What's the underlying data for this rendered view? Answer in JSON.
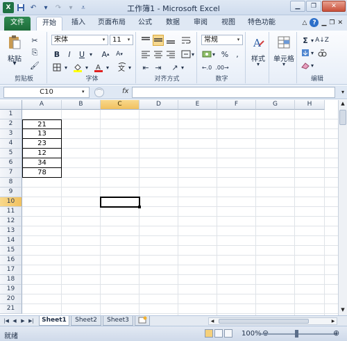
{
  "window": {
    "title": "工作簿1 - Microsoft Excel",
    "app_icon": "X"
  },
  "ribbon_tabs": [
    "文件",
    "开始",
    "插入",
    "页面布局",
    "公式",
    "数据",
    "审阅",
    "视图",
    "特色功能"
  ],
  "ribbon": {
    "clipboard": {
      "paste": "粘贴",
      "group_label": "剪贴板"
    },
    "font": {
      "name": "宋体",
      "size": "11",
      "bold": "B",
      "italic": "I",
      "underline": "U",
      "group_label": "字体"
    },
    "alignment": {
      "group_label": "对齐方式"
    },
    "number": {
      "format": "常规",
      "percent": "%",
      "group_label": "数字"
    },
    "styles": {
      "label": "样式"
    },
    "cells": {
      "label": "单元格"
    },
    "editing": {
      "group_label": "编辑"
    }
  },
  "formula_bar": {
    "name_box": "C10",
    "fx": "fx",
    "value": ""
  },
  "columns": [
    "A",
    "B",
    "C",
    "D",
    "E",
    "F",
    "G",
    "H"
  ],
  "rows": [
    "1",
    "2",
    "3",
    "4",
    "5",
    "6",
    "7",
    "8",
    "9",
    "10",
    "11",
    "12",
    "13",
    "14",
    "15",
    "16",
    "17",
    "18",
    "19",
    "20",
    "21"
  ],
  "cells": {
    "a2": "21",
    "a3": "13",
    "a4": "23",
    "a5": "12",
    "a6": "34",
    "a7": "78"
  },
  "active_cell": "C10",
  "sheets": [
    "Sheet1",
    "Sheet2",
    "Sheet3"
  ],
  "status": {
    "ready": "就绪",
    "zoom": "100%"
  },
  "colors": {
    "file_tab": "#1d6c3a",
    "selection_header": "#f1c15f",
    "ribbon_bg": "#e7eef8"
  }
}
